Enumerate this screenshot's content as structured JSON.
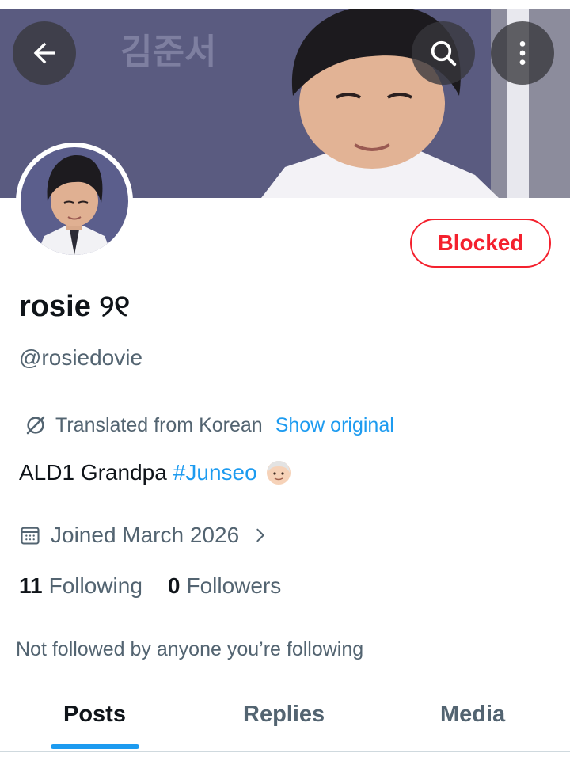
{
  "header": {
    "banner_caption": "김준서",
    "back_icon": "arrow-left-icon",
    "search_icon": "search-icon",
    "more_icon": "more-vertical-icon"
  },
  "profile": {
    "block_label": "Blocked",
    "display_name": "rosie ୨୧",
    "handle": "@rosiedovie",
    "translation": {
      "note": "Translated from Korean",
      "show_original": "Show original"
    },
    "bio": {
      "text": "ALD1 Grandpa",
      "hashtag": "#Junseo",
      "emoji": "older-man-emoji"
    },
    "joined": "Joined March 2026",
    "following_count": "11",
    "following_label": "Following",
    "followers_count": "0",
    "followers_label": "Followers",
    "not_followed_note": "Not followed by anyone you’re following"
  },
  "tabs": [
    {
      "label": "Posts",
      "active": true
    },
    {
      "label": "Replies",
      "active": false
    },
    {
      "label": "Media",
      "active": false
    }
  ],
  "colors": {
    "accent": "#1d9bf0",
    "blocked": "#f4212e",
    "secondary_text": "#536471",
    "primary_text": "#0f1419"
  }
}
